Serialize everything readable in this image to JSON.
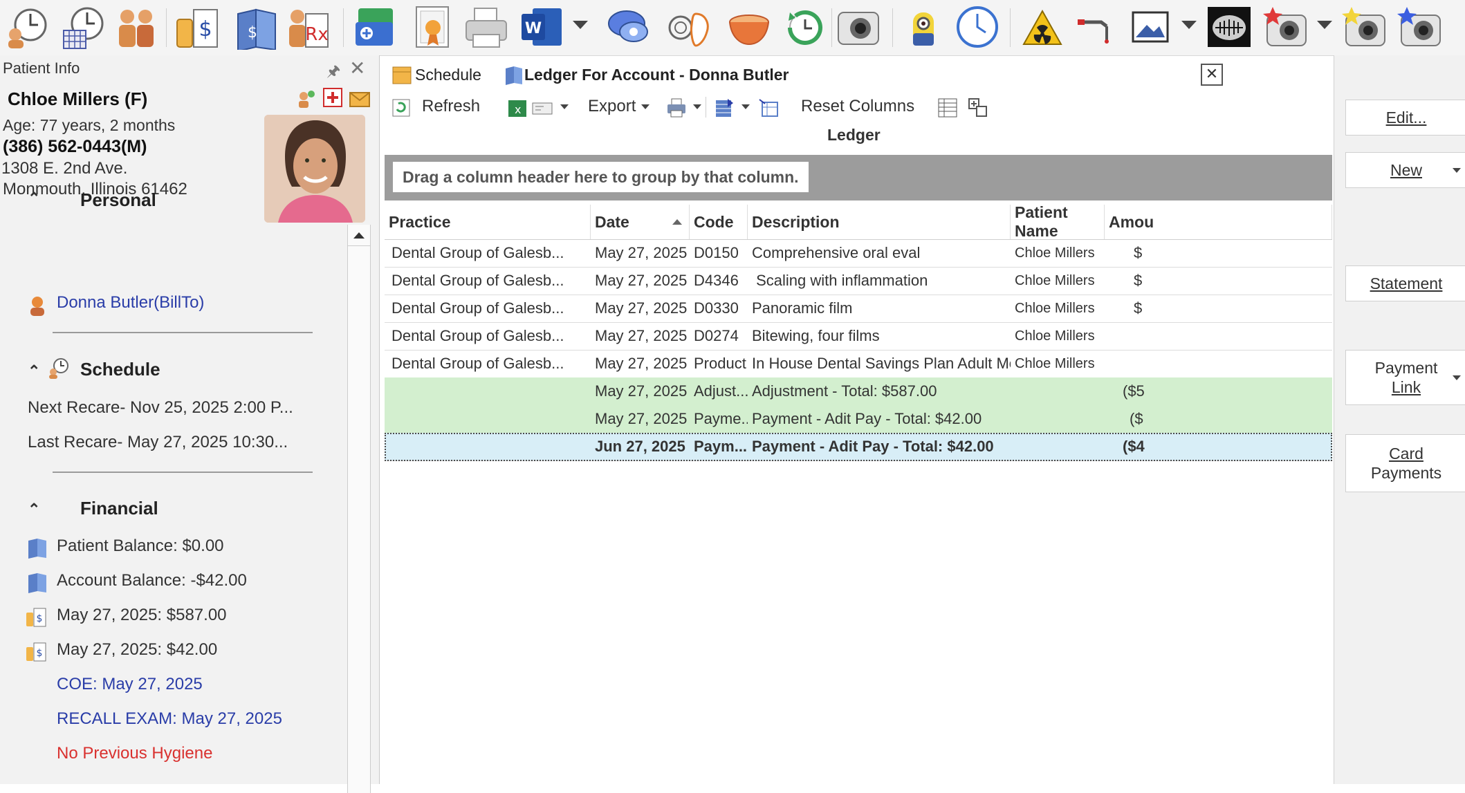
{
  "toolbar": {
    "icons": [
      "appointment-clock-icon",
      "schedule-calendar-icon",
      "family-icon",
      "billing-icon",
      "ledger-book-icon",
      "prescription-icon",
      "insurance-card-icon",
      "certificate-icon",
      "printer-icon",
      "word-icon",
      "chat-icon",
      "lungs-icon",
      "bowl-icon",
      "history-icon",
      "camera-icon",
      "minion-icon",
      "clock-icon",
      "radiation-warning-icon",
      "dental-handpiece-icon",
      "image-viewer-icon",
      "xray-icon",
      "camera-red-star-icon",
      "camera-yellow-star-icon",
      "camera-blue-star-icon"
    ]
  },
  "left_panel": {
    "title": "Patient Info",
    "patient": {
      "name": "Chloe Millers (F)",
      "age": "Age: 77 years, 2 months",
      "phone": "(386) 562-0443(M)",
      "address1": "1308 E. 2nd Ave.",
      "address2": "Monmouth, Illinois 61462"
    },
    "personal": {
      "heading": "Personal",
      "bill_to": "Donna Butler(BillTo)"
    },
    "schedule": {
      "heading": "Schedule",
      "next_recare": "Next Recare- Nov 25, 2025 2:00 P...",
      "last_recare": "Last Recare- May 27, 2025 10:30..."
    },
    "financial": {
      "heading": "Financial",
      "patient_balance": "Patient Balance: $0.00",
      "account_balance": "Account Balance: -$42.00",
      "charge1": "May 27, 2025: $587.00",
      "charge2": "May 27, 2025: $42.00",
      "coe": "COE: May 27, 2025",
      "recall_exam": "RECALL EXAM: May 27, 2025",
      "no_hygiene": "No Previous Hygiene"
    }
  },
  "tabs": {
    "schedule": "Schedule",
    "ledger": "Ledger For Account - Donna Butler"
  },
  "subbar": {
    "refresh": "Refresh",
    "export": "Export",
    "reset_columns": "Reset Columns"
  },
  "grid": {
    "title": "Ledger",
    "group_hint": "Drag a column header here to group by that column.",
    "columns": [
      "Practice",
      "Date",
      "Code",
      "Description",
      "Patient Name",
      "Amou"
    ],
    "rows": [
      {
        "practice": "Dental Group of Galesb...",
        "date": "May 27, 2025",
        "code": "D0150",
        "description": "Comprehensive oral eval",
        "patient": "Chloe Millers",
        "amount": "$"
      },
      {
        "practice": "Dental Group of Galesb...",
        "date": "May 27, 2025",
        "code": "D4346",
        "description": " Scaling with inflammation",
        "patient": "Chloe Millers",
        "amount": "$"
      },
      {
        "practice": "Dental Group of Galesb...",
        "date": "May 27, 2025",
        "code": "D0330",
        "description": "Panoramic film",
        "patient": "Chloe Millers",
        "amount": "$"
      },
      {
        "practice": "Dental Group of Galesb...",
        "date": "May 27, 2025",
        "code": "D0274",
        "description": "Bitewing, four films",
        "patient": "Chloe Millers",
        "amount": ""
      },
      {
        "practice": "Dental Group of Galesb...",
        "date": "May 27, 2025",
        "code": "Product",
        "description": "In House Dental Savings Plan Adult Monthly",
        "patient": "Chloe Millers",
        "amount": ""
      },
      {
        "practice": "",
        "date": "May 27, 2025",
        "code": "Adjust...",
        "description": "Adjustment - Total: $587.00",
        "patient": "",
        "amount": "($5"
      },
      {
        "practice": "",
        "date": "May 27, 2025",
        "code": "Payme...",
        "description": "Payment - Adit Pay - Total: $42.00",
        "patient": "",
        "amount": "($"
      },
      {
        "practice": "",
        "date": "Jun 27, 2025",
        "code": "Paym...",
        "description": "Payment - Adit Pay - Total: $42.00",
        "patient": "",
        "amount": "($4"
      }
    ]
  },
  "right_panel": {
    "edit": "Edit...",
    "new": "New",
    "statement": "Statement",
    "payment_link_1": "Payment",
    "payment_link_2": "Link",
    "card_payments_1": "Card",
    "card_payments_2": "Payments"
  },
  "colors": {
    "adjust_row": "#d3efcf",
    "selected_row": "#d8eef7",
    "link": "#2a3da8",
    "warning": "#d9312f"
  }
}
